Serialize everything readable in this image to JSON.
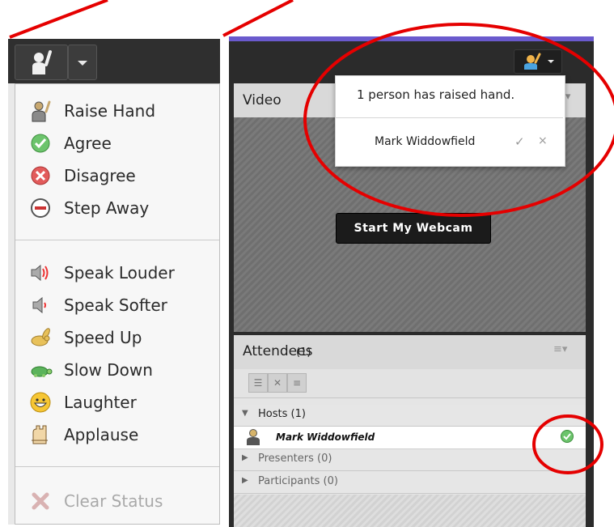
{
  "status_menu": {
    "items": [
      {
        "label": "Raise Hand",
        "icon": "raise-hand-icon"
      },
      {
        "label": "Agree",
        "icon": "agree-check-icon"
      },
      {
        "label": "Disagree",
        "icon": "disagree-x-icon"
      },
      {
        "label": "Step Away",
        "icon": "step-away-icon"
      },
      {
        "label": "Speak Louder",
        "icon": "speaker-loud-icon"
      },
      {
        "label": "Speak Softer",
        "icon": "speaker-soft-icon"
      },
      {
        "label": "Speed Up",
        "icon": "rabbit-icon"
      },
      {
        "label": "Slow Down",
        "icon": "turtle-icon"
      },
      {
        "label": "Laughter",
        "icon": "smiley-icon"
      },
      {
        "label": "Applause",
        "icon": "clapping-hands-icon"
      },
      {
        "label": "Clear Status",
        "icon": "clear-x-icon",
        "disabled": true
      }
    ]
  },
  "video_pod": {
    "title": "Video",
    "start_webcam_label": "Start My Webcam"
  },
  "raised_hand_popup": {
    "title": "1 person has raised hand.",
    "name": "Mark Widdowfield",
    "check": "✓",
    "close": "×"
  },
  "attendees_pod": {
    "title": "Attendees",
    "count": "(1)",
    "groups": [
      {
        "label": "Hosts (1)",
        "expanded": true
      },
      {
        "label": "Presenters (0)",
        "expanded": false
      },
      {
        "label": "Participants (0)",
        "expanded": false
      }
    ],
    "host": {
      "name": "Mark Widdowfield",
      "status": "agree"
    }
  },
  "colors": {
    "annotation_red": "#e50000",
    "agree_green": "#5cb85c",
    "disagree_red": "#e05555",
    "accent_purple": "#6a5acd"
  }
}
